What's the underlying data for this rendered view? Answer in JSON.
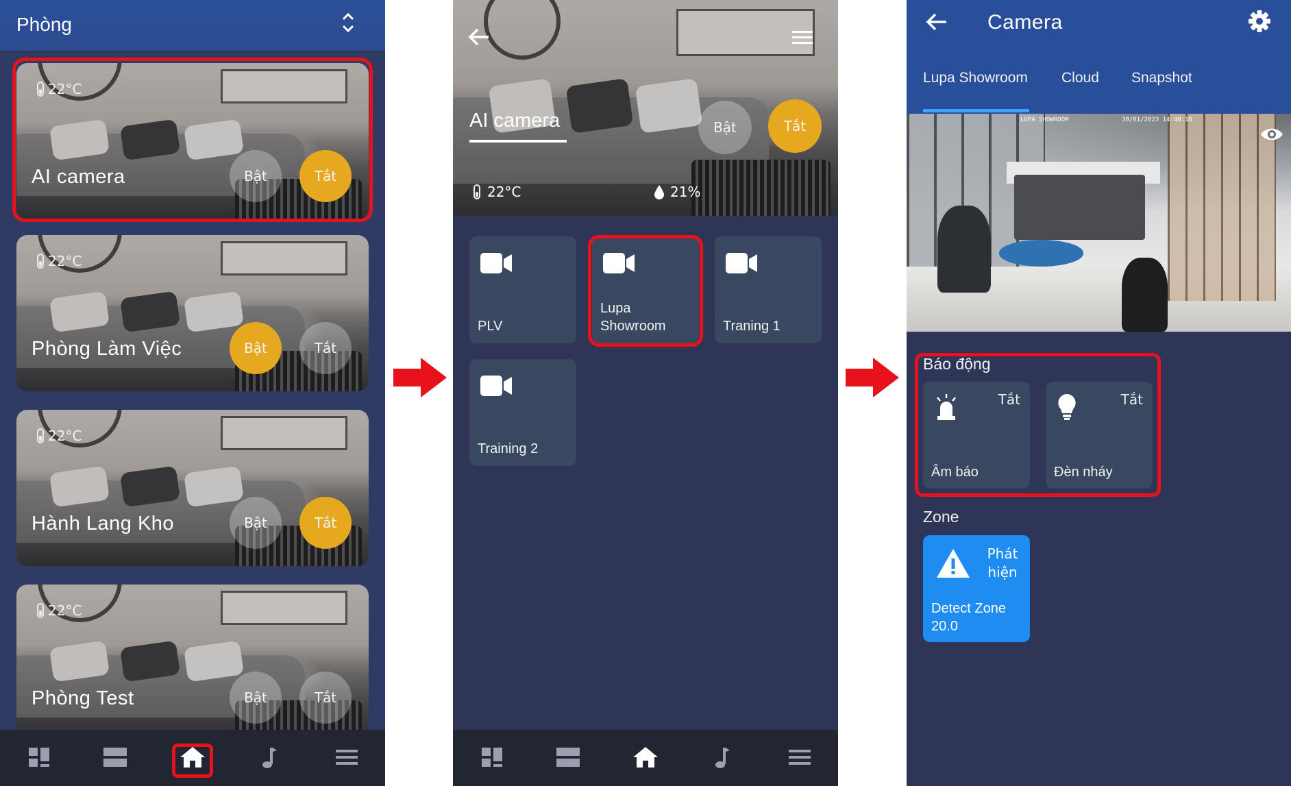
{
  "screen1": {
    "title": "Phòng",
    "rooms": [
      {
        "temp": "22°C",
        "name": "AI camera",
        "bat": "Bật",
        "tat": "Tắt",
        "active": "tat"
      },
      {
        "temp": "22°C",
        "name": "Phòng Làm Việc",
        "bat": "Bật",
        "tat": "Tắt",
        "active": "bat"
      },
      {
        "temp": "22°C",
        "name": "Hành Lang Kho",
        "bat": "Bật",
        "tat": "Tắt",
        "active": "tat"
      },
      {
        "temp": "22°C",
        "name": "Phòng Test",
        "bat": "Bật",
        "tat": "Tắt",
        "active": "none"
      }
    ],
    "nav": [
      "dashboard-icon",
      "list-icon",
      "home-icon",
      "music-icon",
      "menu-icon"
    ]
  },
  "screen2": {
    "room_name": "AI camera",
    "bat": "Bật",
    "tat": "Tắt",
    "temp": "22°C",
    "humidity": "21%",
    "cameras": [
      "PLV",
      "Lupa\nShowroom",
      "Traning 1",
      "Training 2"
    ],
    "nav": [
      "dashboard-icon",
      "list-icon",
      "home-icon",
      "music-icon",
      "menu-icon"
    ]
  },
  "screen3": {
    "title": "Camera",
    "tabs": [
      "Lupa Showroom",
      "Cloud",
      "Snapshot"
    ],
    "feed_label_left": "LUPA SHOWROOM",
    "feed_label_right": "30/01/2023 14:40:10",
    "alarm_section": "Báo động",
    "alarms": [
      {
        "name": "Âm báo",
        "state": "Tắt",
        "icon": "siren-icon"
      },
      {
        "name": "Đèn nháy",
        "state": "Tắt",
        "icon": "bulb-icon"
      }
    ],
    "zone_section": "Zone",
    "zone": {
      "state": "Phát hiện",
      "name": "Detect Zone 20.0",
      "icon": "warning-icon"
    }
  },
  "colors": {
    "accent_orange": "#e6a81e",
    "highlight_red": "#e8121b",
    "zone_blue": "#1e8cf0",
    "header_blue": "#2a4f9a",
    "tile": "#3a4760"
  }
}
